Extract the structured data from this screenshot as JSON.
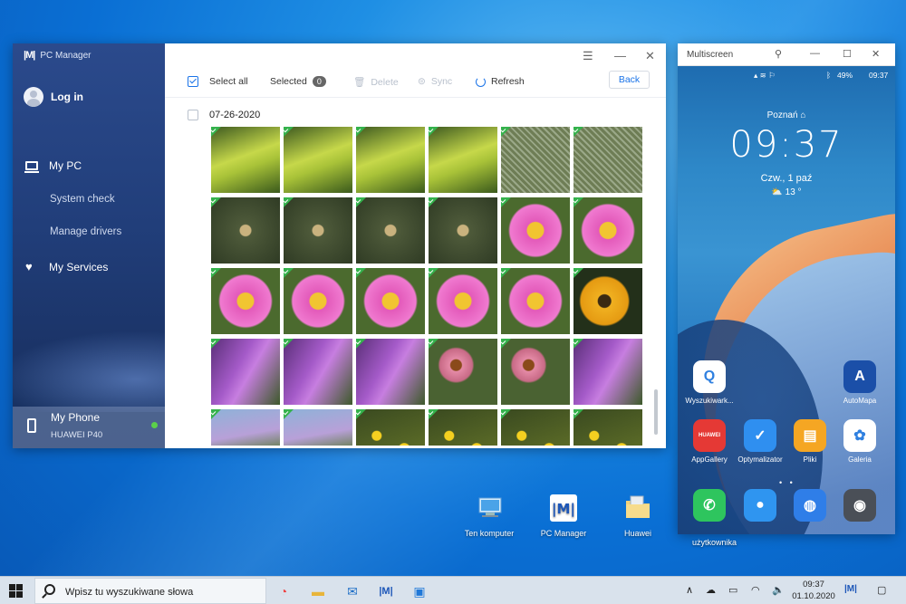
{
  "pc_manager": {
    "app_title": "PC Manager",
    "login_label": "Log in",
    "nav": {
      "my_pc": "My PC",
      "system_check": "System check",
      "manage_drivers": "Manage drivers",
      "my_services": "My Services"
    },
    "phone": {
      "label": "My Phone",
      "model": "HUAWEI P40"
    },
    "toolbar": {
      "select_all": "Select all",
      "selected": "Selected",
      "selected_count": "0",
      "delete": "Delete",
      "sync": "Sync",
      "refresh": "Refresh",
      "back": "Back"
    },
    "gallery": {
      "date": "07-26-2020",
      "photos": [
        {
          "subject": "frog-leaf"
        },
        {
          "subject": "frog-leaf"
        },
        {
          "subject": "frog-leaf"
        },
        {
          "subject": "frog-leaf"
        },
        {
          "subject": "spiderweb"
        },
        {
          "subject": "spiderweb"
        },
        {
          "subject": "spider"
        },
        {
          "subject": "spider"
        },
        {
          "subject": "spider"
        },
        {
          "subject": "spider"
        },
        {
          "subject": "pink-cosmos"
        },
        {
          "subject": "pink-cosmos"
        },
        {
          "subject": "pink-cosmos"
        },
        {
          "subject": "pink-cosmos"
        },
        {
          "subject": "pink-cosmos"
        },
        {
          "subject": "pink-cosmos"
        },
        {
          "subject": "pink-cosmos"
        },
        {
          "subject": "yellow-rudbeckia"
        },
        {
          "subject": "purple-liatris"
        },
        {
          "subject": "purple-liatris"
        },
        {
          "subject": "purple-liatris"
        },
        {
          "subject": "echinacea"
        },
        {
          "subject": "echinacea"
        },
        {
          "subject": "purple-liatris"
        },
        {
          "subject": "purple-meadow"
        },
        {
          "subject": "purple-meadow"
        },
        {
          "subject": "yellow-flowers"
        },
        {
          "subject": "yellow-flowers"
        },
        {
          "subject": "yellow-flowers"
        },
        {
          "subject": "yellow-flowers"
        }
      ]
    }
  },
  "multiscreen": {
    "title": "Multiscreen",
    "status_battery": "49%",
    "status_time": "09:37",
    "city": "Poznań",
    "clock": "09:37",
    "date": "Czw., 1 paź",
    "temperature": "13 °",
    "apps": [
      {
        "label": "Wyszukiwark...",
        "icon": "search-app",
        "color": "#ffffff",
        "glyph": "Q"
      },
      {
        "label": "AutoMapa",
        "icon": "automapa",
        "color": "#1b4fa8",
        "glyph": "A"
      },
      {
        "label": "AppGallery",
        "icon": "appgallery",
        "color": "#e53935",
        "glyph": "HUAWEI"
      },
      {
        "label": "Optymalizator",
        "icon": "shield",
        "color": "#2f8ff0",
        "glyph": "✓"
      },
      {
        "label": "Pliki",
        "icon": "folder",
        "color": "#f5a623",
        "glyph": "▤"
      },
      {
        "label": "Galeria",
        "icon": "gallery",
        "color": "#ffffff",
        "glyph": "✿"
      },
      {
        "label": "",
        "icon": "phone",
        "color": "#2ec55e",
        "glyph": "✆"
      },
      {
        "label": "",
        "icon": "messages",
        "color": "#2f95f0",
        "glyph": "●"
      },
      {
        "label": "",
        "icon": "browser",
        "color": "#2f7ee8",
        "glyph": "◍"
      },
      {
        "label": "",
        "icon": "camera",
        "color": "#4a4f57",
        "glyph": "◉"
      }
    ],
    "under_label": "użytkownika"
  },
  "desktop_icons": [
    {
      "label": "Ten komputer"
    },
    {
      "label": "PC Manager"
    },
    {
      "label": "Huawei"
    }
  ],
  "taskbar": {
    "search_placeholder": "Wpisz tu wyszukiwane słowa",
    "time": "09:37",
    "date": "01.10.2020"
  }
}
